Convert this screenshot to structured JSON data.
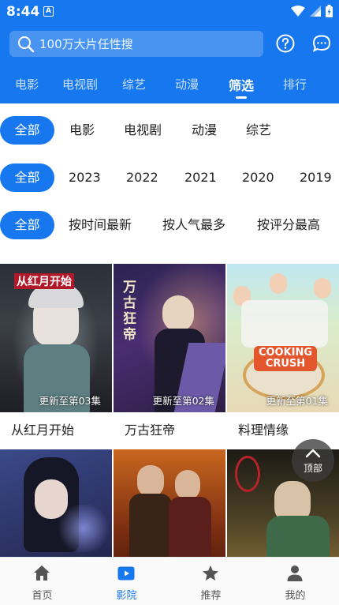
{
  "status_bar": {
    "time": "8:44",
    "notification_glyph": "A"
  },
  "search": {
    "placeholder": "100万大片任性搜"
  },
  "header_icons": [
    "help-icon",
    "message-icon"
  ],
  "tabs": [
    {
      "label": "电影"
    },
    {
      "label": "电视剧"
    },
    {
      "label": "综艺"
    },
    {
      "label": "动漫"
    },
    {
      "label": "筛选",
      "active": true
    },
    {
      "label": "排行"
    }
  ],
  "filters": {
    "type": [
      "全部",
      "电影",
      "电视剧",
      "动漫",
      "综艺"
    ],
    "year": [
      "全部",
      "2023",
      "2022",
      "2021",
      "2020",
      "2019"
    ],
    "sort": [
      "全部",
      "按时间最新",
      "按人气最多",
      "按评分最高"
    ]
  },
  "items": [
    {
      "title": "从红月开始",
      "update": "更新至第03集",
      "poster_text": "从红月开始"
    },
    {
      "title": "万古狂帝",
      "update": "更新至第02集",
      "poster_text": "万古狂帝"
    },
    {
      "title": "料理情缘",
      "update": "更新至第01集",
      "poster_text": "COOKING CRUSH"
    },
    {
      "title": "",
      "update": ""
    },
    {
      "title": "",
      "update": ""
    },
    {
      "title": "",
      "update": ""
    }
  ],
  "back_to_top": {
    "label": "顶部"
  },
  "bottom_nav": [
    {
      "label": "首页",
      "icon": "home-icon"
    },
    {
      "label": "影院",
      "icon": "video-icon",
      "active": true
    },
    {
      "label": "推荐",
      "icon": "star-icon"
    },
    {
      "label": "我的",
      "icon": "user-icon"
    }
  ],
  "colors": {
    "accent": "#1677ee"
  }
}
